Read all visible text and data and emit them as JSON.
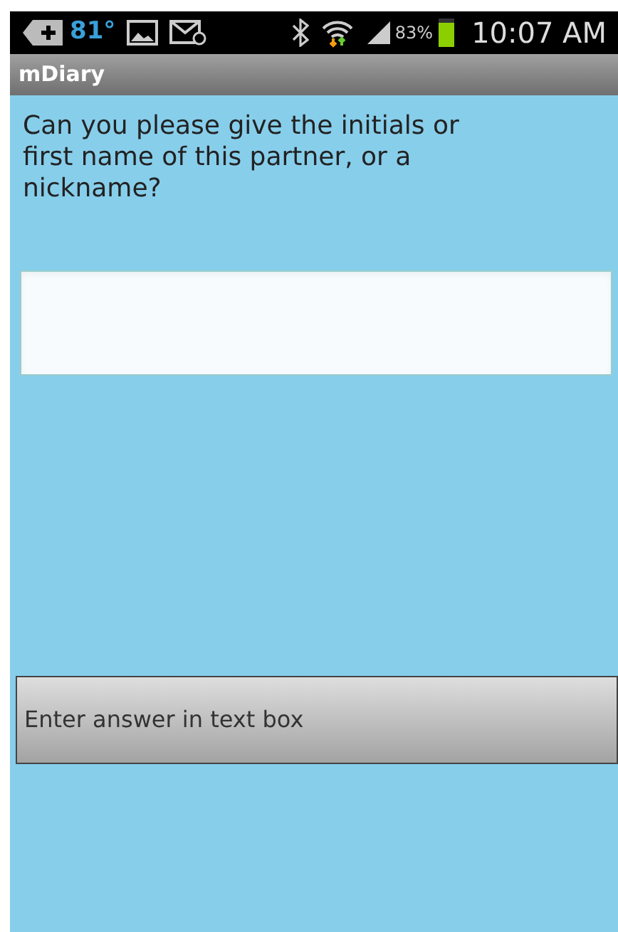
{
  "status_bar": {
    "temperature": "81°",
    "battery_percent": "83%",
    "time": "10:07 AM"
  },
  "app_bar": {
    "title": "mDiary"
  },
  "question": "Can you please give the initials or first name of this partner, or a nickname?",
  "button": {
    "label": "Enter answer in text box"
  }
}
